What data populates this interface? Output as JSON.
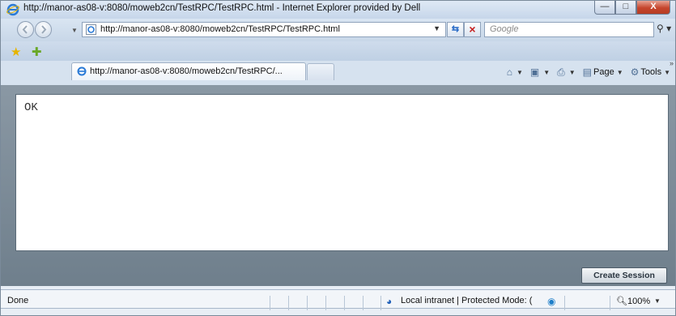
{
  "window": {
    "title": "http://manor-as08-v:8080/moweb2cn/TestRPC/TestRPC.html - Internet Explorer provided by Dell",
    "minimize_label": "—",
    "maximize_label": "□",
    "close_label": "X"
  },
  "address": {
    "url": "http://manor-as08-v:8080/moweb2cn/TestRPC/TestRPC.html",
    "search_placeholder": "Google"
  },
  "tab": {
    "label": "http://manor-as08-v:8080/moweb2cn/TestRPC/..."
  },
  "commandbar": {
    "page_label": "Page",
    "tools_label": "Tools"
  },
  "content": {
    "output_text": "OK",
    "create_session_label": "Create Session"
  },
  "statusbar": {
    "status": "Done",
    "zone": "Local intranet | Protected Mode: (",
    "zoom": "100%"
  },
  "icons": {
    "ie": "ie-logo-icon",
    "back": "back-arrow-icon",
    "forward": "forward-arrow-icon",
    "refresh": "refresh-icon",
    "stop": "stop-icon",
    "search": "search-icon",
    "favorites": "favorites-star-icon",
    "add_favorites": "add-favorites-icon",
    "home": "home-icon",
    "feeds": "feeds-icon",
    "print": "print-icon",
    "page": "page-icon",
    "tools": "gear-icon",
    "zone": "intranet-globe-icon",
    "zoom": "magnifier-icon"
  }
}
